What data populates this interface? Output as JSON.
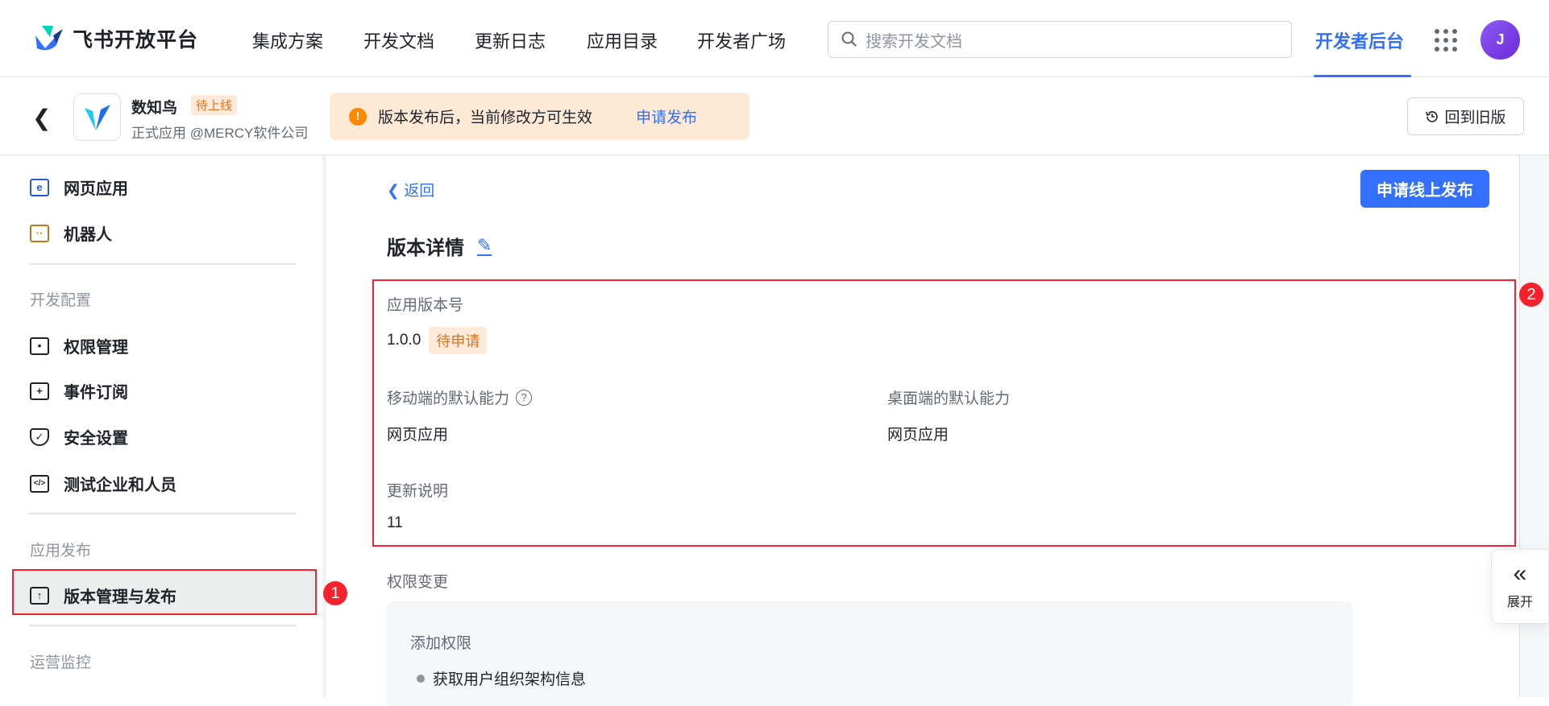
{
  "header": {
    "logo_text": "飞书开放平台",
    "nav": [
      "集成方案",
      "开发文档",
      "更新日志",
      "应用目录",
      "开发者广场"
    ],
    "search_placeholder": "搜索开发文档",
    "dev_console": "开发者后台",
    "avatar_initial": "J"
  },
  "app": {
    "name": "数知鸟",
    "status_badge": "待上线",
    "subtitle": "正式应用 @MERCY软件公司"
  },
  "alert": {
    "message": "版本发布后，当前修改方可生效",
    "action": "申请发布"
  },
  "old_version_button": "回到旧版",
  "sidebar": {
    "items_top": [
      {
        "label": "网页应用",
        "icon": "web-app-icon"
      },
      {
        "label": "机器人",
        "icon": "robot-icon"
      }
    ],
    "groups": [
      {
        "title": "开发配置",
        "items": [
          {
            "label": "权限管理"
          },
          {
            "label": "事件订阅"
          },
          {
            "label": "安全设置"
          },
          {
            "label": "测试企业和人员"
          }
        ]
      },
      {
        "title": "应用发布",
        "items": [
          {
            "label": "版本管理与发布"
          }
        ]
      },
      {
        "title": "运营监控",
        "items": []
      }
    ]
  },
  "markers": [
    "1",
    "2"
  ],
  "main": {
    "back": "返回",
    "publish_button": "申请线上发布",
    "title": "版本详情",
    "version_label": "应用版本号",
    "version": "1.0.0",
    "version_status": "待申请",
    "mobile_label": "移动端的默认能力",
    "mobile_value": "网页应用",
    "desktop_label": "桌面端的默认能力",
    "desktop_value": "网页应用",
    "notes_label": "更新说明",
    "notes_value": "11",
    "perm_title": "权限变更",
    "perm_add": "添加权限",
    "perm_items": [
      "获取用户组织架构信息"
    ]
  },
  "expand_label": "展开"
}
